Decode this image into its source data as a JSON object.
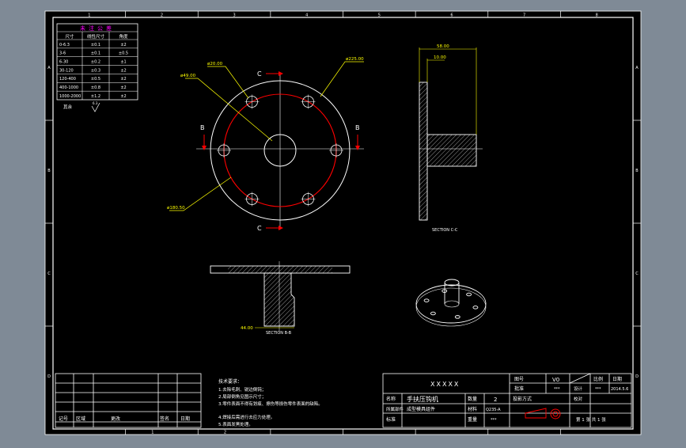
{
  "colors": {
    "frame_bg": "#8a949f",
    "sheet_bg": "#000000",
    "line": "#ffffff",
    "dimension": "#ffff00",
    "bolt_circle": "#ff0000",
    "accent": "#ff00ff"
  },
  "border": {
    "top_zones": [
      "1",
      "2",
      "3",
      "4",
      "5",
      "6",
      "7",
      "8"
    ],
    "side_zones": [
      "A",
      "B",
      "C",
      "D"
    ],
    "bottom_zones": [
      "1",
      "2"
    ]
  },
  "tolerance_table": {
    "title": "未注公差",
    "headers": [
      "尺寸",
      "线性尺寸",
      "角度"
    ],
    "rows": [
      [
        "0-6.3",
        "±0.1",
        "±2"
      ],
      [
        "3-6",
        "±0.1",
        "±0.5"
      ],
      [
        "6-30",
        "±0.2",
        "±1"
      ],
      [
        "30-120",
        "±0.3",
        "±2"
      ],
      [
        "120-400",
        "±0.5",
        "±2"
      ],
      [
        "400-1000",
        "±0.8",
        "±2"
      ],
      [
        "1000-2000",
        "±1.2",
        "±2"
      ]
    ],
    "roughness_label": "其余"
  },
  "top_view": {
    "dim_hole": "ø20.00",
    "dim_center": "ø49.00",
    "dim_outer": "ø225.00",
    "dim_pcd": "ø180.50",
    "label_c": "C",
    "label_b": "B"
  },
  "section_cc": {
    "dim_total": "58.00",
    "dim_flange": "10.00",
    "label": "SECTION C-C"
  },
  "section_bb": {
    "dim_bottom": "44.00",
    "label": "SECTION B-B"
  },
  "tech_notes": {
    "title": "技术要求：",
    "lines": [
      "1.去除毛刺、锐边倒钝；",
      "2.局部倒角见图示尺寸；",
      "3.零件表面不得有划痕、擦伤等损伤零件表面的缺陷。",
      "4.焊接后需进行去应力处理。",
      "5.表面发黑处理。"
    ]
  },
  "revision_block": {
    "headers": [
      "记号",
      "区域",
      "更改",
      "签名",
      "日期"
    ]
  },
  "title_block": {
    "company": "XXXXX",
    "drawing_no_label": "图号",
    "version": "V0",
    "ratio_label": "比例",
    "date_label": "日期",
    "date": "2014.5.6",
    "approved_label": "批准",
    "approved_val": "***",
    "design_label": "设计",
    "design_val": "***",
    "check_label": "校对",
    "check_val": "***",
    "part_name_label": "名称",
    "part_name": "手扶压钩机",
    "qty_label": "数量",
    "qty": "2",
    "material_label": "材料",
    "material": "Q235-A",
    "assembly_label": "所属部件",
    "assembly": "成型模具组件",
    "standard_label": "标准",
    "standard": "",
    "weight_label": "重量",
    "weight": "***",
    "projection_label": "投影方式",
    "sheet_label": "第 1 张  共 1 张"
  }
}
